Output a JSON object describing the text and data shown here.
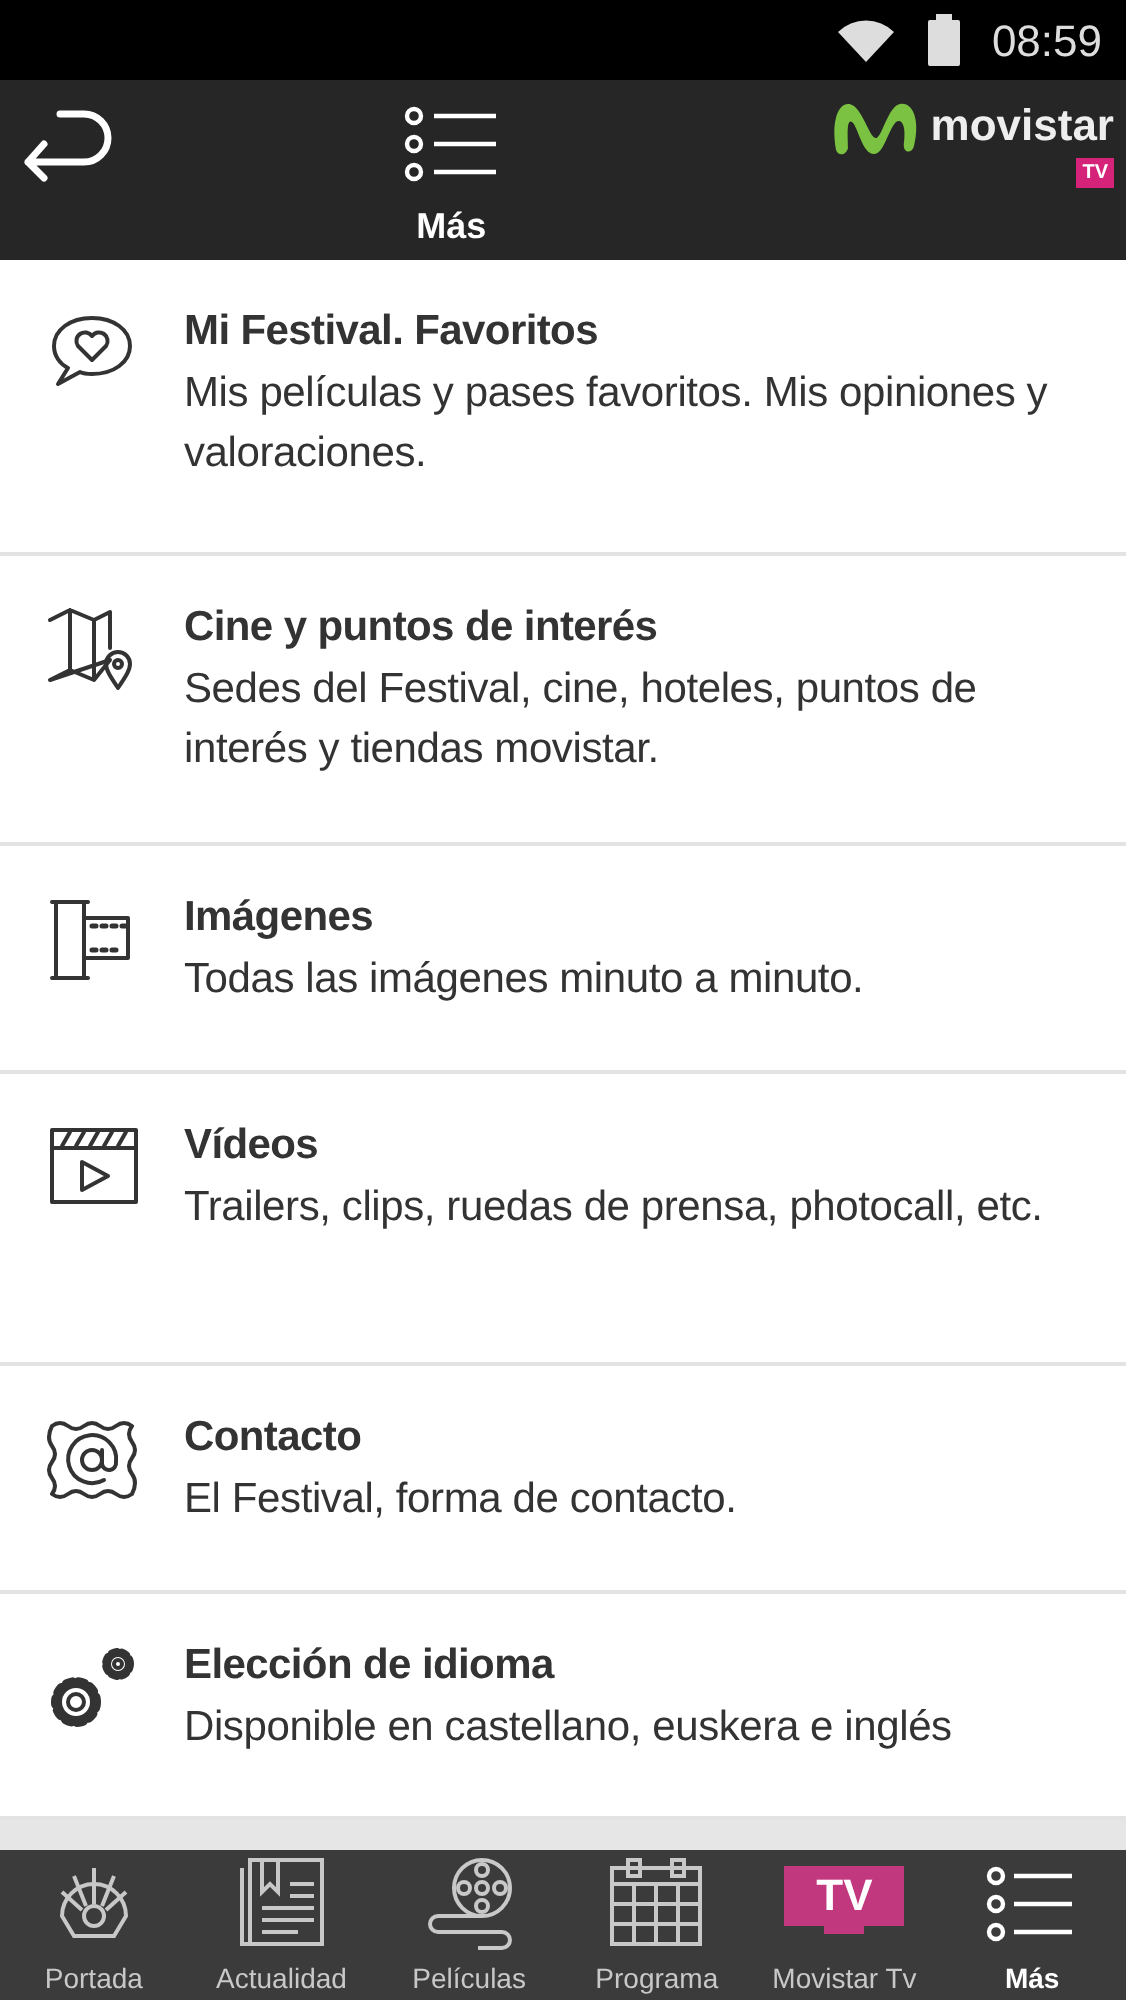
{
  "status_bar": {
    "time": "08:59"
  },
  "header": {
    "title": "Más",
    "logo_text": "movistar",
    "logo_badge": "TV"
  },
  "menu_items": [
    {
      "kind": "heart-bubble",
      "title": "Mi Festival. Favoritos",
      "subtitle": "Mis películas y pases favoritos. Mis opiniones y valoraciones."
    },
    {
      "kind": "map",
      "title": "Cine y puntos de interés",
      "subtitle": "Sedes del Festival, cine, hoteles, puntos de interés y tiendas movistar."
    },
    {
      "kind": "film",
      "title": "Imágenes",
      "subtitle": "Todas las imágenes minuto a minuto."
    },
    {
      "kind": "video",
      "title": "Vídeos",
      "subtitle": "Trailers, clips, ruedas de prensa, photocall, etc."
    },
    {
      "kind": "at",
      "title": "Contacto",
      "subtitle": "El Festival, forma de contacto."
    },
    {
      "kind": "gears",
      "title": "Elección de idioma",
      "subtitle": "Disponible en castellano, euskera e inglés"
    }
  ],
  "tab_bar": [
    {
      "kind": "emblem",
      "label": "Portada",
      "selected": false
    },
    {
      "kind": "news",
      "label": "Actualidad",
      "selected": false
    },
    {
      "kind": "reel",
      "label": "Películas",
      "selected": false
    },
    {
      "kind": "calendar",
      "label": "Programa",
      "selected": false
    },
    {
      "kind": "tv",
      "label": "Movistar Tv",
      "badge": "TV",
      "selected": false
    },
    {
      "kind": "list",
      "label": "Más",
      "selected": true
    }
  ]
}
